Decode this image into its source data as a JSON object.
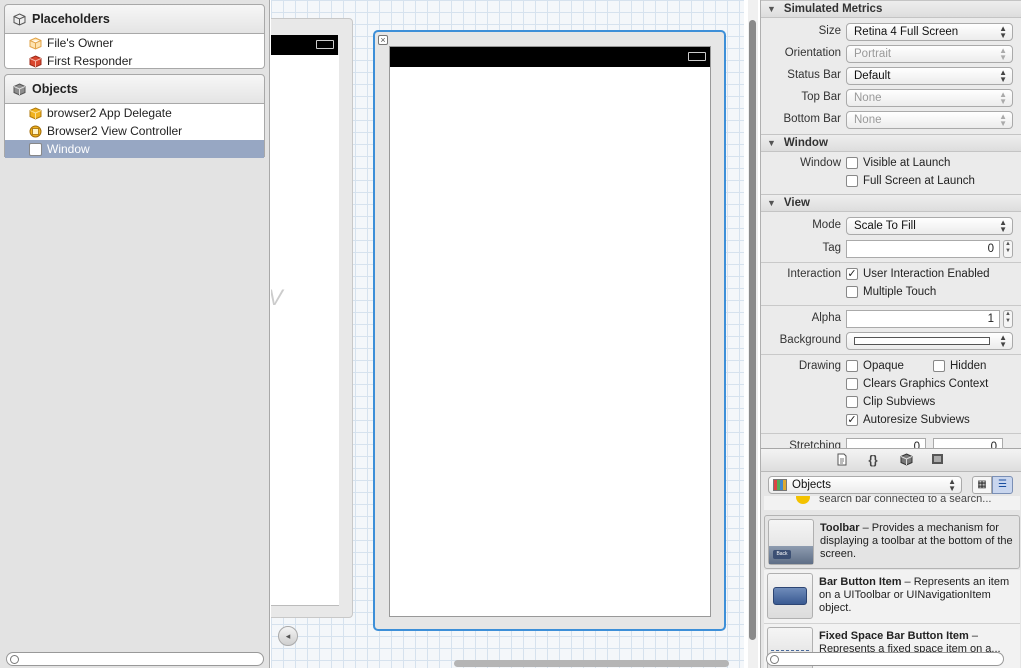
{
  "outline": {
    "placeholders_title": "Placeholders",
    "placeholders": [
      {
        "label": "File's Owner",
        "icon": "cube-wireframe-icon",
        "color": "#f0b95a"
      },
      {
        "label": "First Responder",
        "icon": "red-cube-icon",
        "color": "#d9462e"
      }
    ],
    "objects_title": "Objects",
    "objects": [
      {
        "label": "browser2 App Delegate",
        "icon": "yellow-cube-icon",
        "color": "#f0b21e"
      },
      {
        "label": "Browser2 View Controller",
        "icon": "view-controller-icon",
        "color": "#e8a21f"
      },
      {
        "label": "Window",
        "icon": "window-icon",
        "color": "#ffffff",
        "selected": true
      }
    ]
  },
  "canvas": {
    "watermark_char": "V"
  },
  "inspector": {
    "simulated_metrics": {
      "title": "Simulated Metrics",
      "size_label": "Size",
      "size_value": "Retina 4 Full Screen",
      "orientation_label": "Orientation",
      "orientation_value": "Portrait",
      "status_bar_label": "Status Bar",
      "status_bar_value": "Default",
      "top_bar_label": "Top Bar",
      "top_bar_value": "None",
      "bottom_bar_label": "Bottom Bar",
      "bottom_bar_value": "None"
    },
    "window": {
      "title": "Window",
      "row_label": "Window",
      "visible_at_launch": "Visible at Launch",
      "full_screen_at_launch": "Full Screen at Launch"
    },
    "view": {
      "title": "View",
      "mode_label": "Mode",
      "mode_value": "Scale To Fill",
      "tag_label": "Tag",
      "tag_value": "0",
      "interaction_label": "Interaction",
      "user_interaction": "User Interaction Enabled",
      "multiple_touch": "Multiple Touch",
      "alpha_label": "Alpha",
      "alpha_value": "1",
      "background_label": "Background",
      "drawing_label": "Drawing",
      "opaque": "Opaque",
      "hidden": "Hidden",
      "clears_graphics": "Clears Graphics Context",
      "clip_subviews": "Clip Subviews",
      "autoresize_subviews": "Autoresize Subviews",
      "stretching_label": "Stretching",
      "stretching_x": "0",
      "stretching_y": "0"
    }
  },
  "library": {
    "selector_value": "Objects",
    "partial_text": "search bar connected to a search...",
    "items": [
      {
        "name": "Toolbar",
        "desc": " – Provides a mechanism for displaying a toolbar at the bottom of the screen.",
        "icon": "toolbar-icon",
        "thumb_label": "Back"
      },
      {
        "name": "Bar Button Item",
        "desc": " – Represents an item on a UIToolbar or UINavigationItem object.",
        "icon": "bar-button-item-icon"
      },
      {
        "name": "Fixed Space Bar Button Item",
        "desc": " – Represents a fixed space item on a...",
        "icon": "fixed-space-icon"
      }
    ]
  }
}
